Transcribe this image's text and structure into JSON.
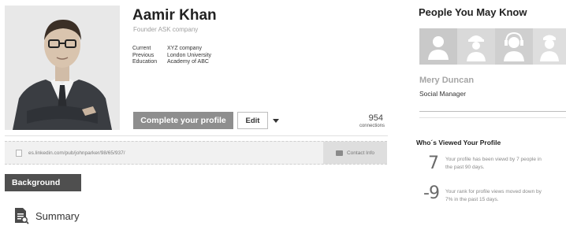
{
  "profile": {
    "name": "Aamir Khan",
    "headline": "Founder ASK company",
    "facts": [
      {
        "label": "Current",
        "value": "XYZ company"
      },
      {
        "label": "Previous",
        "value": "London University"
      },
      {
        "label": "Education",
        "value": "Academy of ABC"
      }
    ],
    "complete_profile_label": "Complete your profile",
    "edit_label": "Edit",
    "connections_count": "954",
    "connections_label": "connections",
    "public_url": "es.linkedin.com/pub/johnparker/98/65/937/",
    "contact_info_label": "Contact Info"
  },
  "sections": {
    "background_label": "Background",
    "summary_label": "Summary"
  },
  "people_you_may_know": {
    "title": "People You May Know",
    "avatars": [
      "person-icon",
      "worker-icon",
      "headset-icon",
      "doctor-icon"
    ],
    "suggested_name": "Mery Duncan",
    "suggested_role": "Social Manager"
  },
  "whos_viewed": {
    "title": "Who´s Viewed Your Profile",
    "stats": [
      {
        "number": "7",
        "text": "Your profile has been viewd by 7 people in the past 90 days."
      },
      {
        "number": "-9",
        "text": "Your rank for profile views moved down by 7% in the past 15 days."
      }
    ]
  },
  "colors": {
    "primary_button": "#8e8e8e",
    "section_label": "#4f4f4f",
    "muted_text": "#a0a0a0"
  }
}
